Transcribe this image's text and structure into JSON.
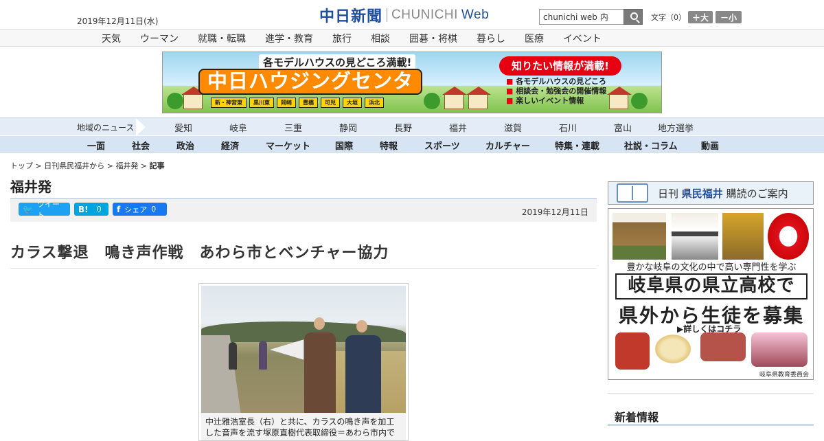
{
  "header": {
    "date": "2019年12月11日(水)",
    "logo_jp": "中日新聞",
    "logo_en": "CHUNICHI",
    "logo_web": "Web",
    "search_value": "chunichi web 内",
    "font_size_label": "文字（0）",
    "font_big": "＋大",
    "font_small": "－小"
  },
  "category_nav": [
    "天気",
    "ウーマン",
    "就職・転職",
    "進学・教育",
    "旅行",
    "相談",
    "囲碁・将棋",
    "暮らし",
    "医療",
    "イベント"
  ],
  "banner": {
    "top_text": "各モデルハウスの見どころ満載!",
    "title": "中日ハウジングセンター",
    "cities": [
      "新・神宮東",
      "黒川東",
      "岡崎",
      "豊橋",
      "可児",
      "大垣",
      "浜北"
    ],
    "info_badge": "知りたい情報が満載!",
    "info_list": [
      "各モデルハウスの見どころ",
      "相談会・勉強会の開催情報",
      "楽しいイベント情報"
    ]
  },
  "region_nav": {
    "label": "地域のニュース",
    "items": [
      "愛知",
      "岐阜",
      "三重",
      "静岡",
      "長野",
      "福井",
      "滋賀",
      "石川",
      "富山",
      "地方選挙"
    ]
  },
  "main_nav": [
    "一面",
    "社会",
    "政治",
    "経済",
    "マーケット",
    "国際",
    "特報",
    "スポーツ",
    "カルチャー",
    "特集・連載",
    "社説・コラム",
    "動画"
  ],
  "breadcrumb": {
    "items": [
      "トップ",
      "日刊県民福井から",
      "福井発"
    ],
    "current": "記事",
    "separator": " > "
  },
  "article": {
    "section": "福井発",
    "share": {
      "tweet": "ツイート",
      "hatena_count": "0",
      "fb_share": "シェア",
      "fb_count": "0"
    },
    "date": "2019年12月11日",
    "headline": "カラス撃退　鳴き声作戦　あわら市とベンチャー協力",
    "photo_caption": "中辻雅浩室長（右）と共に、カラスの鳴き声を加工した音声を流す塚原直樹代表取締役＝あわら市内で"
  },
  "sidebar": {
    "ad1_prefix": "日刊",
    "ad1_name": "県民福井",
    "ad1_suffix": "購読のご案内",
    "ad2_sub": "豊かな岐阜の文化の中で高い専門性を学ぶ",
    "ad2_box": "岐阜県の県立高校で",
    "ad2_main": "県外から生徒を募集",
    "ad2_more": "▶詳しくはコチラ",
    "ad2_foot": "岐阜県教育委員会",
    "news_title": "新着情報"
  },
  "colors": {
    "brand_blue": "#1f4e9c",
    "twitter": "#1da1f2",
    "hatena": "#00a4de",
    "facebook": "#1877f2"
  }
}
